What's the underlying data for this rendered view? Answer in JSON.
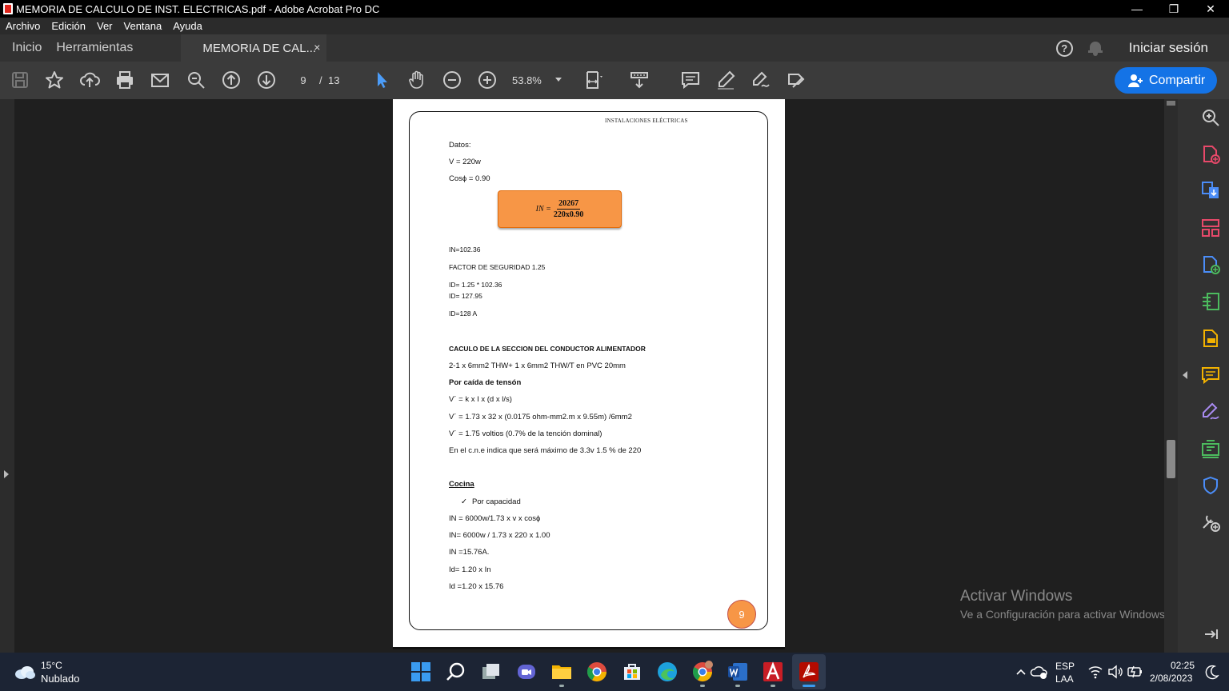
{
  "window": {
    "title": "MEMORIA DE CALCULO DE INST. ELECTRICAS.pdf - Adobe Acrobat Pro DC",
    "minimize": "—",
    "restore": "❐",
    "close": "✕"
  },
  "menu": [
    "Archivo",
    "Edición",
    "Ver",
    "Ventana",
    "Ayuda"
  ],
  "tabs": {
    "home": "Inicio",
    "tools": "Herramientas",
    "document": "MEMORIA DE CAL...",
    "close": "×"
  },
  "account": {
    "help": "?",
    "signin": "Iniciar sesión"
  },
  "toolbar": {
    "current_page": "9",
    "page_separator": "/",
    "total_pages": "13",
    "zoom": "53.8%",
    "share_label": "Compartir"
  },
  "document": {
    "header": "INSTALACIONES ELÉCTRICAS",
    "lines": {
      "datos": "Datos:",
      "voltage": "V = 220w",
      "cos": "Cosϕ = 0.90",
      "in_result": "IN=102.36",
      "factor": "FACTOR DE SEGURIDAD   1.25",
      "id_calc": "ID= 1.25 * 102.36",
      "id_value": "ID= 127.95",
      "id_round": "ID=128 A",
      "section_title": "CACULO DE LA SECCION DEL CONDUCTOR ALIMENTADOR",
      "conductor": "2-1 x 6mm2 THW+ 1 x 6mm2 THW/T en PVC 20mm",
      "caida_title": "Por caída de tensón",
      "vformula": "V´ = k x I x (d x l/s)",
      "vcalc": "V´ = 1.73 x 32 x (0.0175 ohm-mm2.m x 9.55m) /6mm2",
      "vresult": "V´ = 1.75 voltios (0.7% de la tención dominal)",
      "cne": "En el c.n.e indica que será máximo de 3.3v 1.5 % de 220",
      "cocina": "Cocina",
      "check_item": "Por capacidad",
      "in_formula": "IN = 6000w/1.73 x v x cosϕ",
      "in_calc": "IN= 6000w / 1.73 x 220 x 1.00",
      "in_val": "IN =15.76A.",
      "id_formula": "Id= 1.20 x In",
      "id_calc2": "Id =1.20 x 15.76"
    },
    "formula": {
      "lhs": "IN =",
      "numerator": "20267",
      "denominator": "220x0.90"
    },
    "page_badge": "9",
    "check_mark": "✓"
  },
  "watermark": {
    "line1": "Activar Windows",
    "line2": "Ve a Configuración para activar Windows."
  },
  "taskbar": {
    "temperature": "15°C",
    "condition": "Nublado",
    "language_top": "ESP",
    "language_bottom": "LAA",
    "time": "02:25",
    "date": "2/08/2023"
  },
  "colors": {
    "accent": "#1473e6",
    "formula_fill": "#f79646",
    "tool_pink": "#e8496a",
    "tool_blue": "#4b8df8",
    "tool_green": "#4cbb5e",
    "tool_yellow": "#f3b200",
    "tool_purple": "#a98bf2"
  }
}
